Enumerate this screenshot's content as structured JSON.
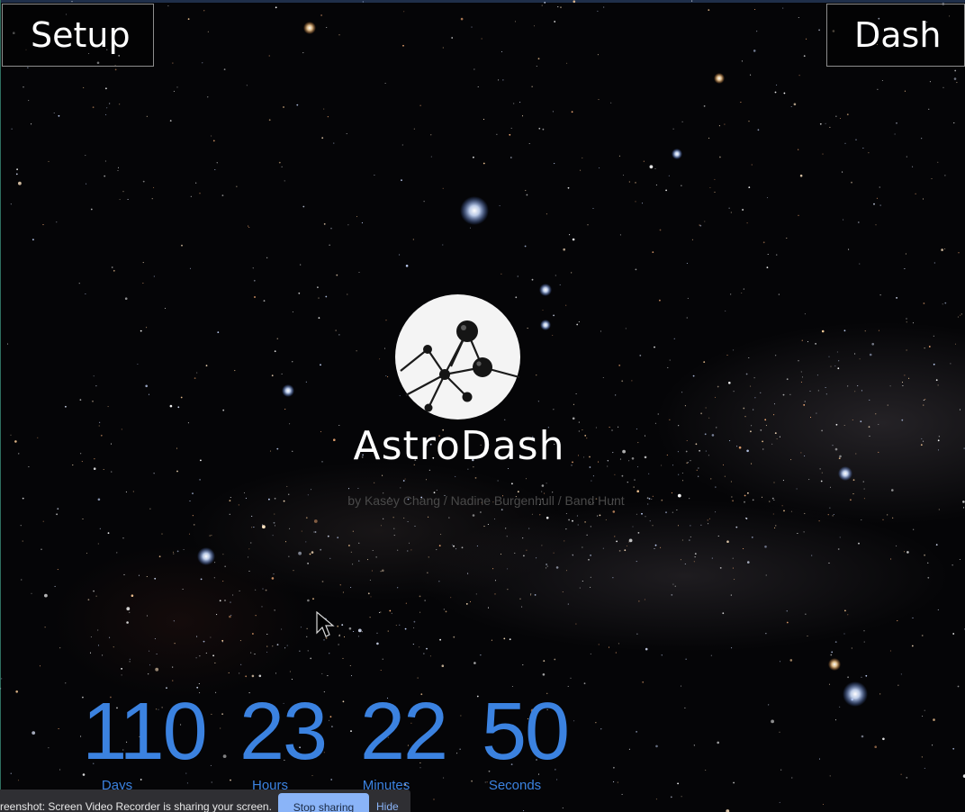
{
  "nav": {
    "setup_label": "Setup",
    "dash_label": "Dash"
  },
  "brand": {
    "title": "AstroDash",
    "credits": "by Kasey Chang / Nadine Burgenhull / Band Hunt",
    "logo_icon": "constellation-logo-icon"
  },
  "countdown": [
    {
      "value": "110",
      "label": "Days"
    },
    {
      "value": "23",
      "label": "Hours"
    },
    {
      "value": "22",
      "label": "Minutes"
    },
    {
      "value": "50",
      "label": "Seconds"
    }
  ],
  "share_bar": {
    "message": "creenshot: Screen Video Recorder is sharing your screen.",
    "stop_label": "Stop sharing",
    "hide_label": "Hide"
  },
  "colors": {
    "countdown": "#3b82e0",
    "background": "#050507",
    "stop_button": "#8ab4f8"
  }
}
